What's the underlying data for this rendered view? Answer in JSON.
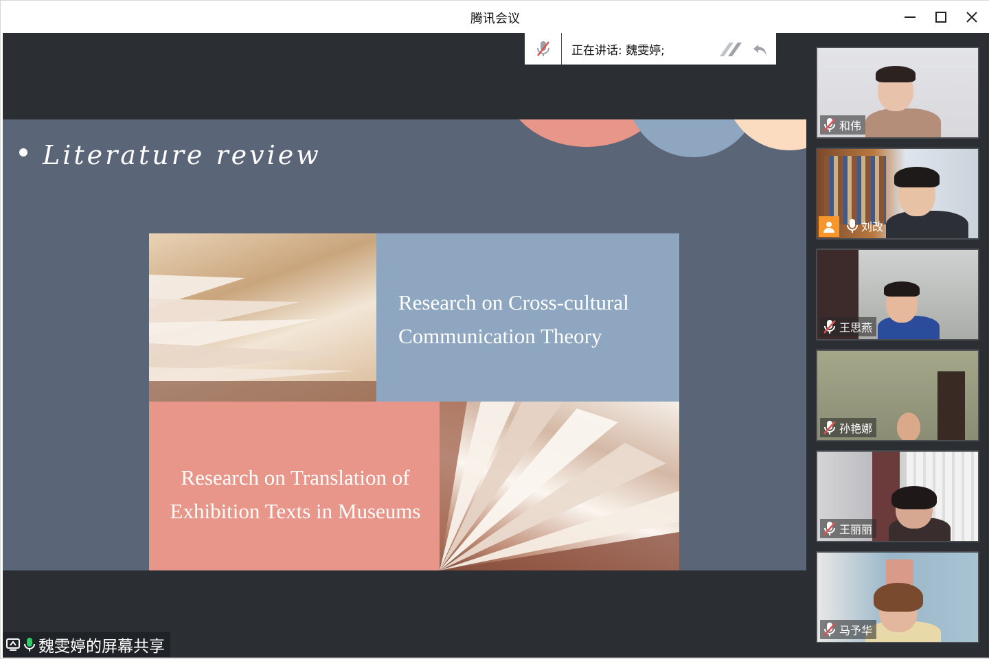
{
  "window": {
    "title": "腾讯会议"
  },
  "speaker_bar": {
    "speaking_text": "正在讲话: 魏雯婷;"
  },
  "slide": {
    "title": "Literature review",
    "panel_top_text_line1": "Research on Cross-cultural",
    "panel_top_text_line2": "Communication Theory",
    "panel_bottom_text_line1": "Research on Translation of",
    "panel_bottom_text_line2": "Exhibition Texts in Museums",
    "colors": {
      "background": "#5a6577",
      "blue_panel": "#8ea6bf",
      "coral_panel": "#e8968a",
      "circle_coral": "#e8968a",
      "circle_blue": "#8ea6bf",
      "circle_peach": "#fbdcc0"
    }
  },
  "share_tag": {
    "label": "魏雯婷的屏幕共享"
  },
  "participants": [
    {
      "name": "和伟",
      "mic": "muted",
      "icon": "mic-muted-icon"
    },
    {
      "name": "刘改",
      "mic": "active",
      "icon": "mic-icon",
      "badge": "user-avatar-icon"
    },
    {
      "name": "王思燕",
      "mic": "muted",
      "icon": "mic-muted-icon"
    },
    {
      "name": "孙艳娜",
      "mic": "muted",
      "icon": "mic-muted-icon"
    },
    {
      "name": "王丽丽",
      "mic": "muted",
      "icon": "mic-muted-icon"
    },
    {
      "name": "马予华",
      "mic": "muted",
      "icon": "mic-muted-icon"
    }
  ]
}
